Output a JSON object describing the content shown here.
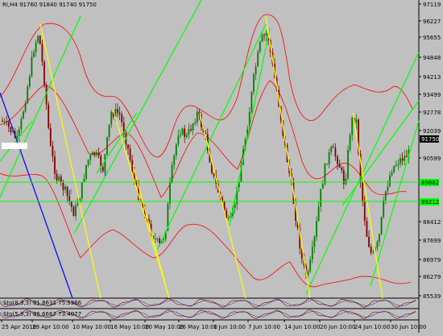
{
  "header": {
    "symbol_line": "RI,H4  91760 91840 91740 91750"
  },
  "price_axis": {
    "labels": [
      "97119",
      "96227",
      "95655",
      "94848",
      "94213",
      "93499",
      "92778",
      "92039",
      "91750",
      "90599",
      "89882",
      "89212",
      "88412",
      "87699",
      "86979",
      "86279",
      "85539"
    ],
    "current_price_label": "91750",
    "level_labels": [
      "89882",
      "89212"
    ]
  },
  "time_axis": {
    "labels": [
      "25 Apr 2016",
      "29 Apr 10:00",
      "10 May 10:00",
      "16 May 10:00",
      "20 May 10:00",
      "26 May 10:00",
      "1 Jun 10:00",
      "7 Jun 10:00",
      "14 Jun 10:00",
      "20 Jun 10:00",
      "24 Jun 10:00",
      "30 Jun 10:00"
    ]
  },
  "indicators": {
    "stoch1_label": "Sto(8,3,3) 91.8631 75.5366",
    "stoch2_label": "Sto(5,3,3) 86.6667 73.4077"
  },
  "colors": {
    "background": "#c0c0c0",
    "bull_candle": "#008000",
    "bear_candle": "#800000",
    "bollinger": "#ff0000",
    "trend_green": "#00ff00",
    "trend_yellow": "#ffff00",
    "trend_blue": "#0000ff",
    "level_line": "#00ff00"
  }
}
